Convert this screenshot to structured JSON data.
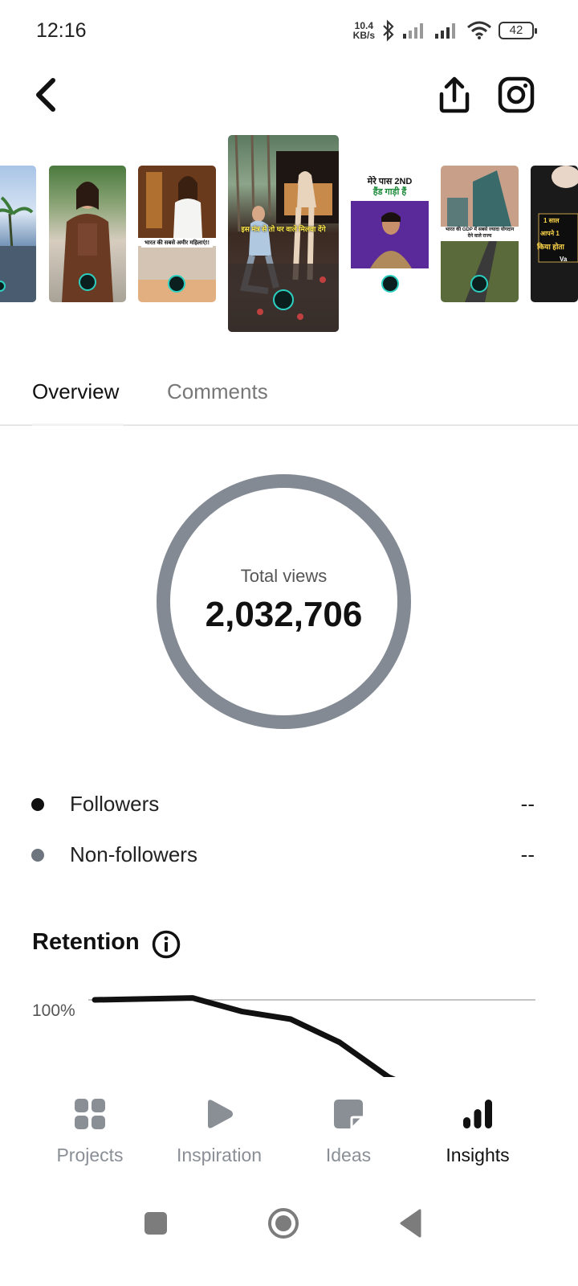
{
  "status_bar": {
    "time": "12:16",
    "speed_value": "10.4",
    "speed_unit": "KB/s",
    "battery": "42"
  },
  "carousel": {
    "captions": [
      "भारत की सबसे अमीर महिलाएं!!",
      "इस मंत्र से तो घर वाले मिलवा देंगे",
      "मेरे पास 2ND",
      "हैंड गाड़ी हैं",
      "भारत की GDP में सबसे ज्यादा योगदान देने वाले राज्य",
      "1 साल",
      "आपने 1",
      "किया होता",
      "Va"
    ]
  },
  "tabs": [
    {
      "label": "Overview",
      "active": true
    },
    {
      "label": "Comments",
      "active": false
    }
  ],
  "overview": {
    "total_views_label": "Total views",
    "total_views_value": "2,032,706"
  },
  "legend": [
    {
      "label": "Followers",
      "value": "--",
      "color": "#111111"
    },
    {
      "label": "Non-followers",
      "value": "--",
      "color": "#6e757e"
    }
  ],
  "retention": {
    "title": "Retention",
    "ylabel": "100%"
  },
  "chart_data": {
    "type": "line",
    "title": "Retention",
    "ylabel": "",
    "yticks": [
      "100%"
    ],
    "series": [
      {
        "values": [
          100,
          100.5,
          97,
          95,
          89,
          80
        ]
      }
    ]
  },
  "bottom_nav": [
    {
      "label": "Projects",
      "icon": "grid-icon",
      "active": false
    },
    {
      "label": "Inspiration",
      "icon": "play-icon",
      "active": false
    },
    {
      "label": "Ideas",
      "icon": "sticky-note-icon",
      "active": false
    },
    {
      "label": "Insights",
      "icon": "bar-chart-icon",
      "active": true
    }
  ],
  "colors": {
    "ring": "#838a94",
    "inactive": "#8a8f96",
    "active": "#111111"
  }
}
